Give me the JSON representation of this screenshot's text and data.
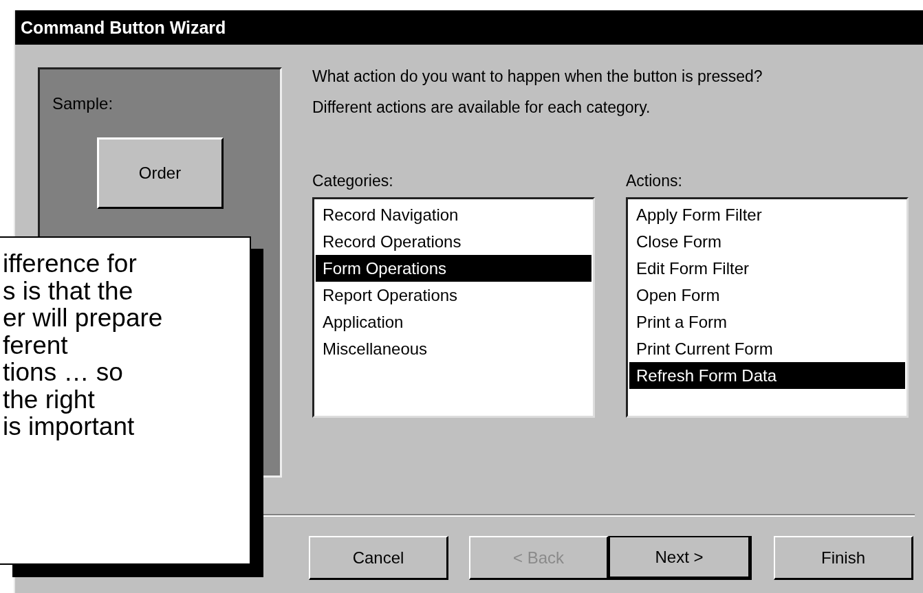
{
  "window": {
    "title": "Command Button Wizard"
  },
  "sample": {
    "label": "Sample:",
    "button": "Order"
  },
  "prompt": "What action do you want to happen when the button is pressed?",
  "hint": "Different actions are available for each category.",
  "categories": {
    "label": "Categories:",
    "items": [
      {
        "label": "Record Navigation",
        "selected": false
      },
      {
        "label": "Record Operations",
        "selected": false
      },
      {
        "label": "Form Operations",
        "selected": true
      },
      {
        "label": "Report Operations",
        "selected": false
      },
      {
        "label": "Application",
        "selected": false
      },
      {
        "label": "Miscellaneous",
        "selected": false
      }
    ]
  },
  "actions": {
    "label": "Actions:",
    "items": [
      {
        "label": "Apply Form Filter",
        "selected": false
      },
      {
        "label": "Close Form",
        "selected": false
      },
      {
        "label": "Edit Form Filter",
        "selected": false
      },
      {
        "label": "Open Form",
        "selected": false
      },
      {
        "label": "Print a Form",
        "selected": false
      },
      {
        "label": "Print Current Form",
        "selected": false
      },
      {
        "label": "Refresh Form Data",
        "selected": true
      }
    ]
  },
  "buttons": [
    {
      "label": "Cancel",
      "disabled": false,
      "default": false
    },
    {
      "label": "< Back",
      "disabled": true,
      "default": false
    },
    {
      "label": "Next >",
      "disabled": false,
      "default": true
    },
    {
      "label": "Finish",
      "disabled": false,
      "default": false
    }
  ],
  "callout": {
    "lines": [
      "ifference for",
      "s is that the",
      "er will prepare",
      "ferent",
      "tions … so",
      "the right",
      "is important"
    ]
  }
}
